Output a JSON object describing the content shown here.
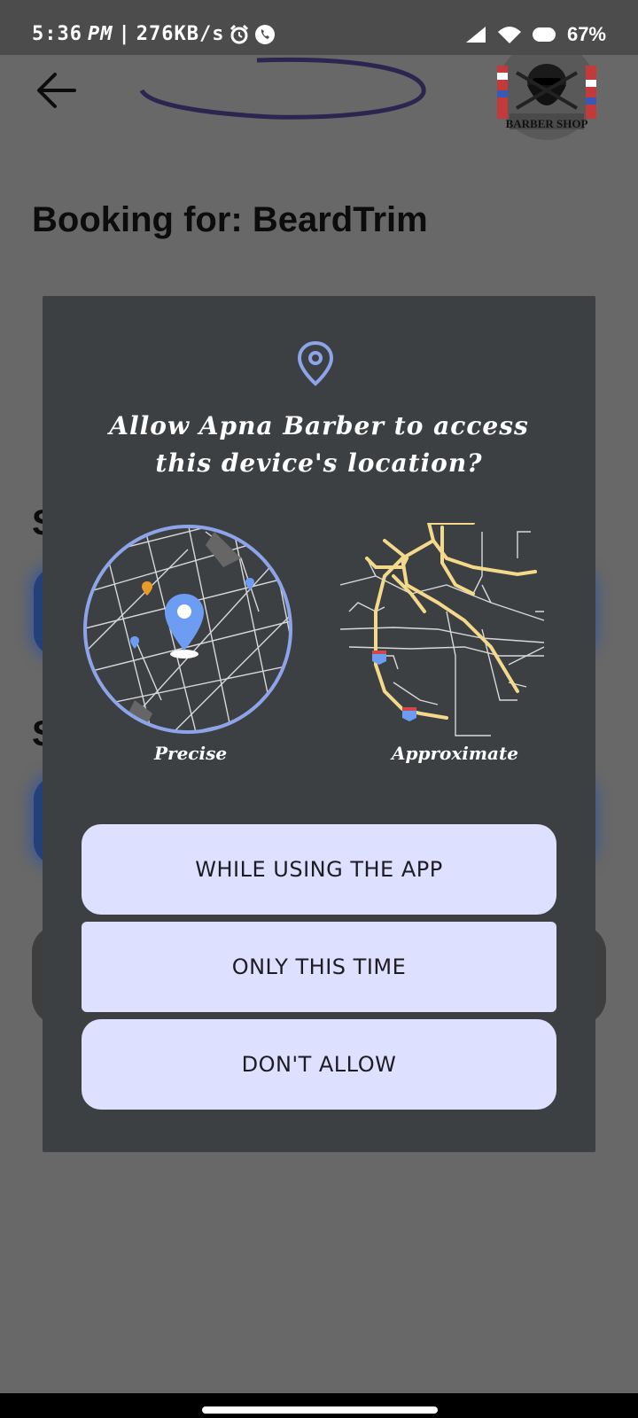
{
  "status_bar": {
    "time": "5:36",
    "ampm": "PM",
    "sep": "|",
    "net_speed": "276KB/s",
    "battery": "67%"
  },
  "header": {
    "logo_text": "BARBER SHOP"
  },
  "page": {
    "title": "Booking for: BeardTrim",
    "partial_letter_1": "S",
    "partial_letter_2": "S"
  },
  "dialog": {
    "title": "Allow Apna Barber to access this device's location?",
    "option_precise": "Precise",
    "option_approximate": "Approximate",
    "buttons": [
      {
        "label": "WHILE USING THE APP"
      },
      {
        "label": "ONLY THIS TIME"
      },
      {
        "label": "DON'T ALLOW"
      }
    ]
  },
  "colors": {
    "accent": "#dde0fe",
    "pin_color": "#8ea4e8",
    "map_blue": "#6c9df2",
    "road_yellow": "#f5d98a"
  },
  "icons": [
    "back-arrow-icon",
    "location-pin-icon",
    "alarm-icon",
    "phone-icon",
    "signal-icon",
    "wifi-icon"
  ]
}
